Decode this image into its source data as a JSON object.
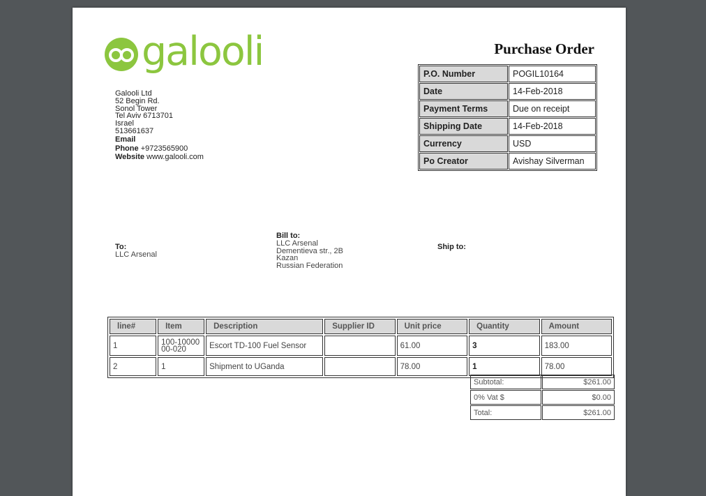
{
  "brand": {
    "logo_text": "galooli",
    "accent_color": "#8cc63f"
  },
  "company": {
    "name": "Galooli Ltd",
    "address1": "52 Begin Rd.",
    "address2": "Sonol Tower",
    "address3": "Tel Aviv 6713701",
    "country": "Israel",
    "reg_number": "513661637",
    "email_label": "Email",
    "phone_label": "Phone",
    "phone": "+9723565900",
    "website_label": "Website",
    "website": "www.galooli.com"
  },
  "document": {
    "title": "Purchase Order"
  },
  "meta": [
    {
      "label": "P.O. Number",
      "value": "POGIL10164"
    },
    {
      "label": "Date",
      "value": "14-Feb-2018"
    },
    {
      "label": "Payment Terms",
      "value": "Due on receipt"
    },
    {
      "label": "Shipping Date",
      "value": "14-Feb-2018"
    },
    {
      "label": "Currency",
      "value": "USD"
    },
    {
      "label": "Po Creator",
      "value": "Avishay Silverman"
    }
  ],
  "to": {
    "label": "To:",
    "name": "LLC Arsenal"
  },
  "bill_to": {
    "label": "Bill to:",
    "lines": [
      "LLC Arsenal",
      "Dementieva str., 2B",
      "Kazan",
      "Russian Federation"
    ]
  },
  "ship_to": {
    "label": "Ship to:"
  },
  "items": {
    "headers": [
      "line#",
      "Item",
      "Description",
      "Supplier ID",
      "Unit price",
      "Quantity",
      "Amount"
    ],
    "rows": [
      {
        "line": "1",
        "item_a": "100-10000",
        "item_b": "00-020",
        "description": "Escort TD-100 Fuel Sensor",
        "supplier_id": "",
        "unit_price": "61.00",
        "quantity": "3",
        "amount": "183.00"
      },
      {
        "line": "2",
        "item": "1",
        "description": "Shipment to UGanda",
        "supplier_id": "",
        "unit_price": "78.00",
        "quantity": "1",
        "amount": "78.00"
      }
    ]
  },
  "totals": [
    {
      "label": "Subtotal:",
      "value": "$261.00"
    },
    {
      "label": "0% Vat $",
      "value": "$0.00"
    },
    {
      "label": "Total:",
      "value": "$261.00"
    }
  ]
}
